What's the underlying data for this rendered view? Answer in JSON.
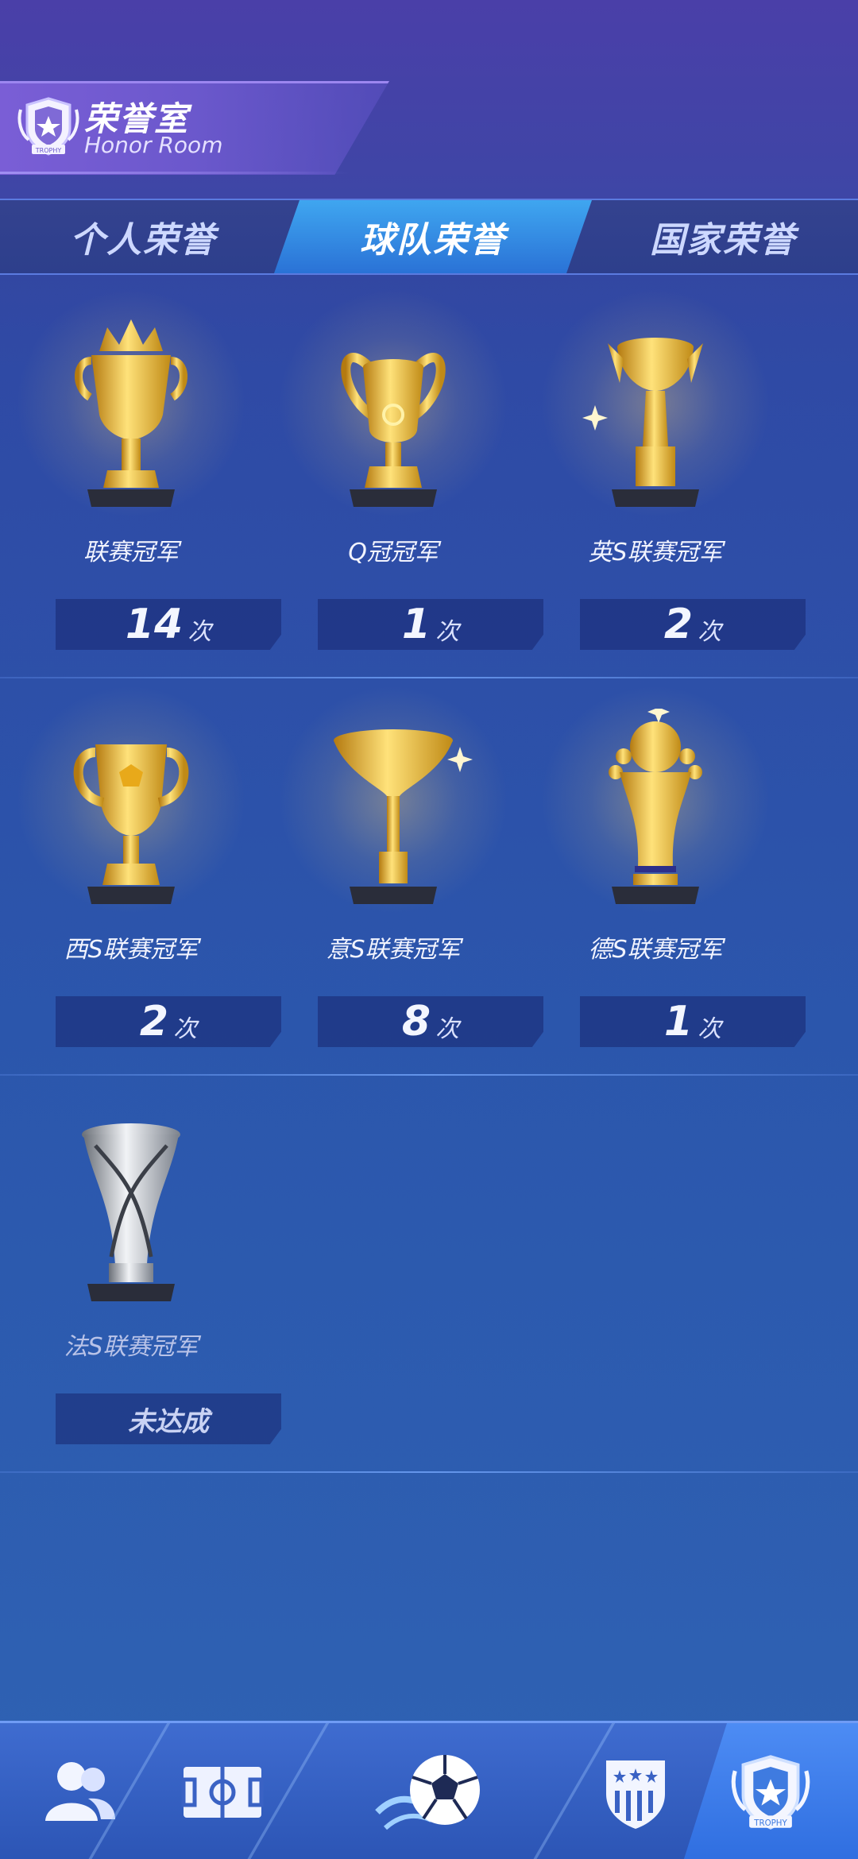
{
  "header": {
    "title": "荣誉室",
    "subtitle": "Honor Room",
    "badge_text": "TROPHY"
  },
  "tabs": [
    {
      "label": "个人荣誉",
      "active": false
    },
    {
      "label": "球队荣誉",
      "active": true
    },
    {
      "label": "国家荣誉",
      "active": false
    }
  ],
  "trophies": [
    {
      "name": "联赛冠军",
      "count": "14",
      "unit": "次",
      "achieved": true,
      "icon": "crown-trophy-icon"
    },
    {
      "name": "Q冠冠军",
      "count": "1",
      "unit": "次",
      "achieved": true,
      "icon": "big-ears-cup-icon"
    },
    {
      "name": "英S联赛冠军",
      "count": "2",
      "unit": "次",
      "achieved": true,
      "icon": "winged-cup-icon"
    },
    {
      "name": "西S联赛冠军",
      "count": "2",
      "unit": "次",
      "achieved": true,
      "icon": "handled-cup-icon"
    },
    {
      "name": "意S联赛冠军",
      "count": "8",
      "unit": "次",
      "achieved": true,
      "icon": "funnel-cup-icon"
    },
    {
      "name": "德S联赛冠军",
      "count": "1",
      "unit": "次",
      "achieved": true,
      "icon": "ball-trophy-icon"
    },
    {
      "name": "法S联赛冠军",
      "status": "未达成",
      "achieved": false,
      "icon": "silver-twisted-trophy-icon"
    }
  ],
  "bottom_nav": [
    {
      "icon": "players-icon",
      "active": false
    },
    {
      "icon": "pitch-icon",
      "active": false
    },
    {
      "icon": "soccer-ball-icon",
      "active": false
    },
    {
      "icon": "club-crest-icon",
      "active": false
    },
    {
      "icon": "trophy-badge-icon",
      "active": true,
      "badge_text": "TROPHY"
    }
  ],
  "colors": {
    "gold": "#f2c23a",
    "silver": "#c9ced6",
    "tab_active": "#3fa6f0"
  }
}
